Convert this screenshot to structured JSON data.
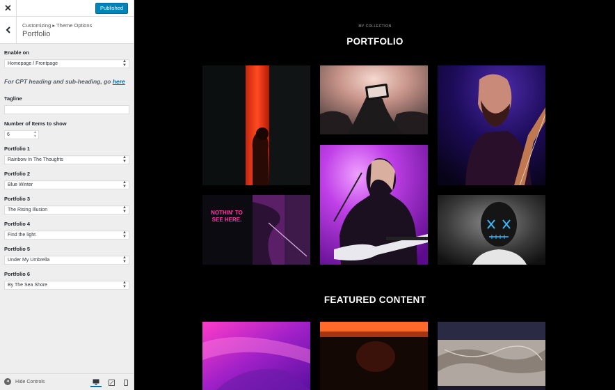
{
  "header": {
    "close_icon": "close-icon",
    "publish_label": "Published",
    "breadcrumb": "Customizing ▸ Theme Options",
    "section_title": "Portfolio"
  },
  "controls": {
    "enable_on": {
      "label": "Enable on",
      "value": "Homepage / Frontpage"
    },
    "cpt_note": {
      "text": "For CPT heading and sub-heading, go ",
      "link": "here"
    },
    "tagline": {
      "label": "Tagline",
      "value": ""
    },
    "num_items": {
      "label": "Number of Items to show",
      "value": "6"
    },
    "portfolios": [
      {
        "label": "Portfolio 1",
        "value": "Rainbow In The Thoughts"
      },
      {
        "label": "Portfolio 2",
        "value": "Blue Winter"
      },
      {
        "label": "Portfolio 3",
        "value": "The Rising Illusion"
      },
      {
        "label": "Portfolio 4",
        "value": "Find the light"
      },
      {
        "label": "Portfolio 5",
        "value": "Under My Umbrella"
      },
      {
        "label": "Portfolio 6",
        "value": "By The Sea Shore"
      }
    ]
  },
  "footer": {
    "hide_controls_label": "Hide Controls",
    "devices": [
      "desktop",
      "tablet",
      "mobile"
    ]
  },
  "preview": {
    "eyebrow": "MY COLLECTION",
    "portfolio_title": "PORTFOLIO",
    "featured_title": "FEATURED CONTENT",
    "neon_sign": "NOTHIN' TO SEE HERE."
  },
  "colors": {
    "accent": "#0085ba",
    "link": "#0073aa",
    "panel_bg": "#eeeeee",
    "preview_bg": "#000000"
  }
}
